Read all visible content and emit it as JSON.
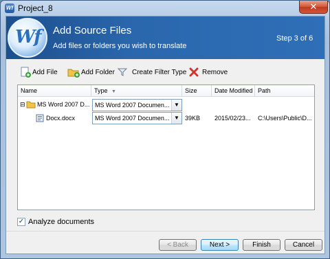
{
  "window": {
    "title": "Project_8",
    "close_glyph": "✕"
  },
  "header": {
    "logo_text": "Wf",
    "title": "Add Source Files",
    "subtitle": "Add files or folders you wish to translate",
    "step": "Step 3 of 6"
  },
  "toolbar": {
    "add_file": "Add File",
    "add_folder": "Add Folder",
    "filter": "Create Filter Type",
    "remove": "Remove"
  },
  "grid": {
    "columns": [
      "Name",
      "Type",
      "Size",
      "Date Modified",
      "Path"
    ],
    "sort_indicator": "▼",
    "rows": [
      {
        "expander": "⊟",
        "name": "MS Word 2007 D...",
        "type": "MS Word 2007 Documen...",
        "size": "",
        "date": "",
        "path": ""
      },
      {
        "expander": "",
        "name": "Docx.docx",
        "type": "MS Word 2007 Documen...",
        "size": "39KB",
        "date": "2015/02/23...",
        "path": "C:\\Users\\Public\\D..."
      }
    ]
  },
  "options": {
    "analyze_label": "Analyze documents",
    "analyze_checked": true,
    "check_glyph": "✓"
  },
  "buttons": {
    "back": "< Back",
    "next": "Next >",
    "finish": "Finish",
    "cancel": "Cancel"
  },
  "colors": {
    "header_blue": "#2a67ad",
    "remove_red": "#d0342c"
  }
}
